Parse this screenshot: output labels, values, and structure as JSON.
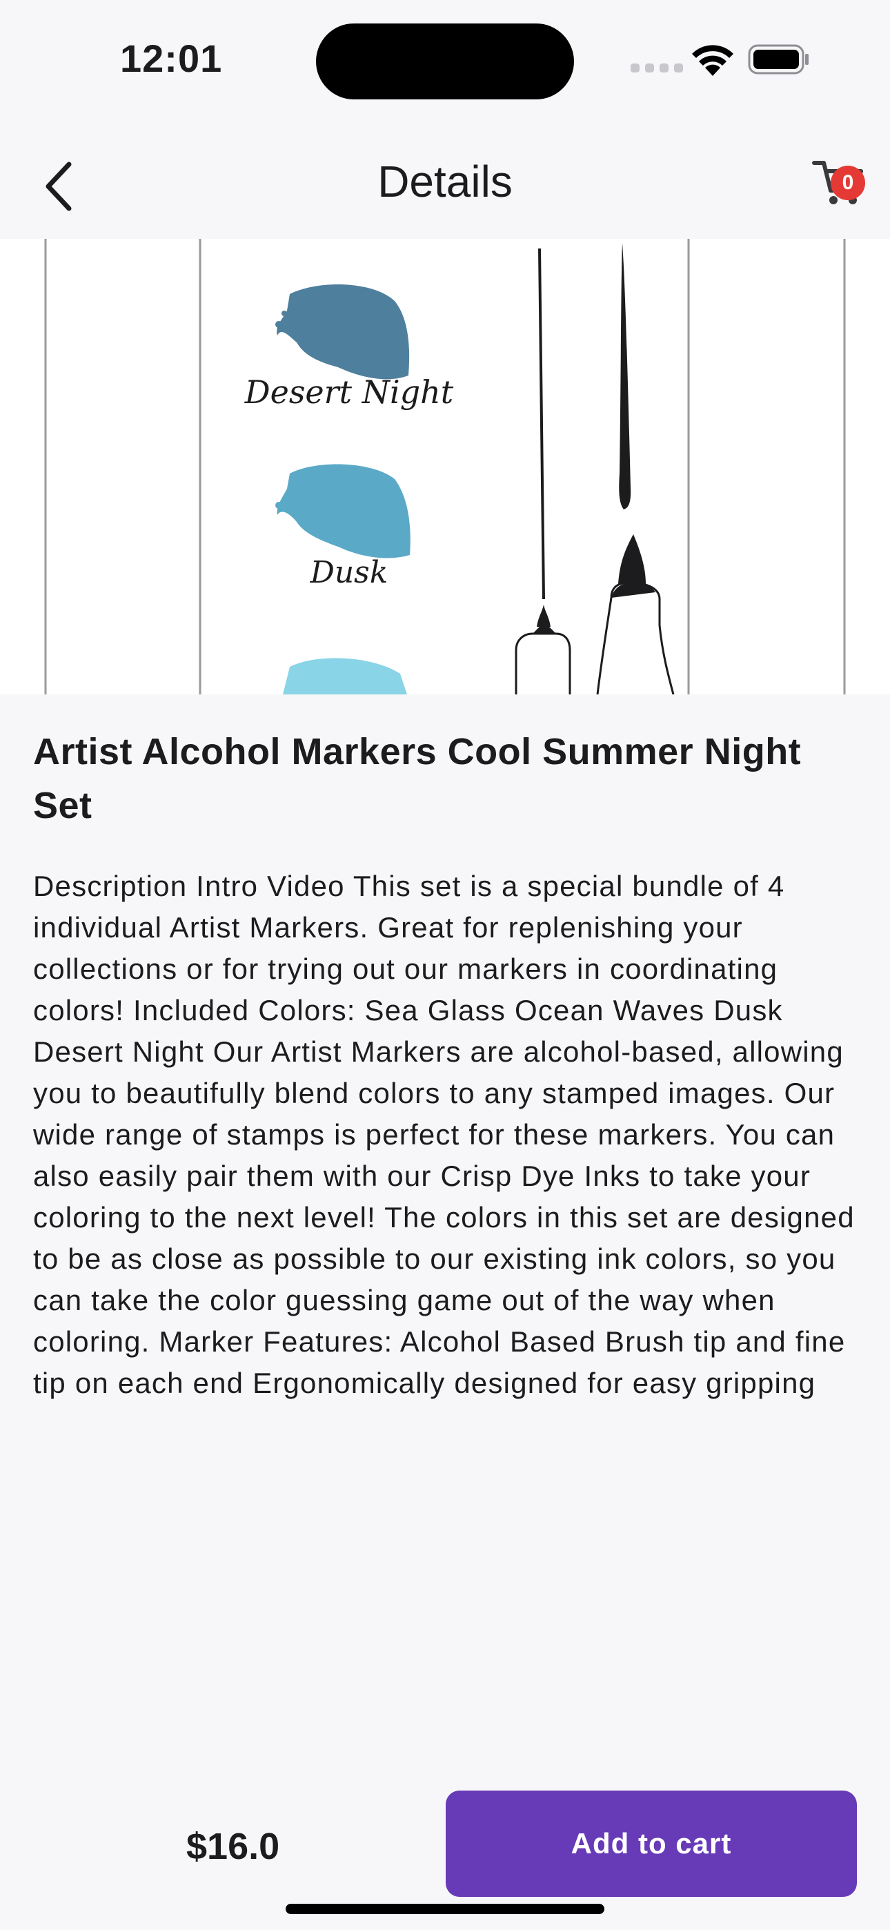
{
  "status_bar": {
    "time": "12:01"
  },
  "nav": {
    "title": "Details",
    "cart_count": "0"
  },
  "image": {
    "swatch_1": "Desert Night",
    "swatch_2": "Dusk"
  },
  "product": {
    "title": "Artist Alcohol Markers Cool Summer Night Set",
    "description": "Description Intro Video This set is a special bundle of 4 individual Artist Markers. Great for replenishing your collections or for trying out our markers in coordinating colors! Included Colors: Sea Glass Ocean Waves Dusk Desert Night Our Artist Markers are alcohol-based, allowing you to beautifully blend colors to any stamped images. Our wide range of stamps is perfect for these markers. You can also easily pair them with our Crisp Dye Inks to take your coloring to the next level! The colors in this set are designed to be as close as possible to our existing ink colors, so you can take the color guessing game out of the way when coloring. Marker Features: Alcohol Based Brush tip and fine tip on each end Ergonomically designed for easy gripping",
    "price": "$16.0"
  },
  "actions": {
    "add_to_cart": "Add to cart"
  },
  "colors": {
    "accent": "#673ab7",
    "badge": "#e53935",
    "swatch_desert_night": "#4e7f9c",
    "swatch_dusk": "#5aa9c7",
    "swatch_sea_glass": "#89d4e6"
  },
  "icons": {
    "back": "chevron-left-icon",
    "cart": "cart-icon",
    "wifi": "wifi-icon",
    "battery": "battery-icon"
  }
}
